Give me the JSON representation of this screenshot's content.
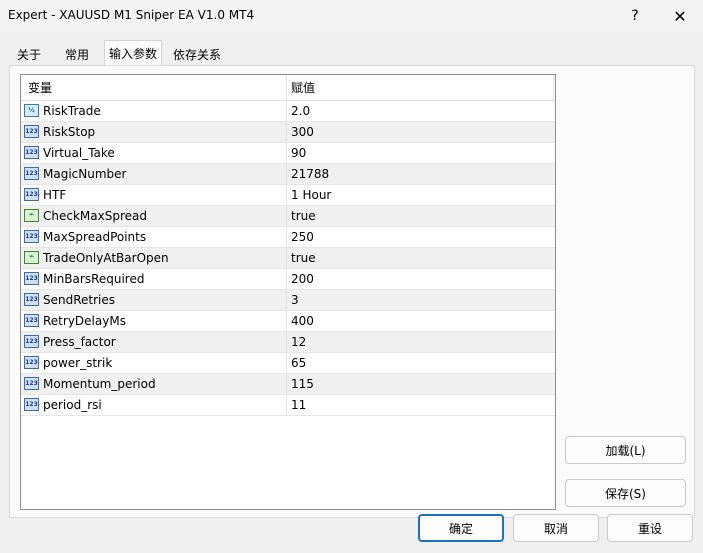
{
  "window": {
    "title": "Expert - XAUUSD M1 Sniper EA V1.0 MT4",
    "help_label": "?",
    "close_label": "✕"
  },
  "tabs": [
    {
      "label": "关于"
    },
    {
      "label": "常用"
    },
    {
      "label": "输入参数"
    },
    {
      "label": "依存关系"
    }
  ],
  "table": {
    "headers": {
      "variable": "变量",
      "value": "赋值"
    },
    "rows": [
      {
        "name": "RiskTrade",
        "value": "2.0",
        "icon": "double-type-icon",
        "glyph": "½"
      },
      {
        "name": "RiskStop",
        "value": "300",
        "icon": "integer-type-icon",
        "glyph": "123"
      },
      {
        "name": "Virtual_Take",
        "value": "90",
        "icon": "integer-type-icon",
        "glyph": "123"
      },
      {
        "name": "MagicNumber",
        "value": "21788",
        "icon": "integer-type-icon",
        "glyph": "123"
      },
      {
        "name": "HTF",
        "value": "1 Hour",
        "icon": "integer-type-icon",
        "glyph": "123"
      },
      {
        "name": "CheckMaxSpread",
        "value": "true",
        "icon": "bool-type-icon",
        "glyph": "⌁"
      },
      {
        "name": "MaxSpreadPoints",
        "value": "250",
        "icon": "integer-type-icon",
        "glyph": "123"
      },
      {
        "name": "TradeOnlyAtBarOpen",
        "value": "true",
        "icon": "bool-type-icon",
        "glyph": "⌁"
      },
      {
        "name": "MinBarsRequired",
        "value": "200",
        "icon": "integer-type-icon",
        "glyph": "123"
      },
      {
        "name": "SendRetries",
        "value": "3",
        "icon": "integer-type-icon",
        "glyph": "123"
      },
      {
        "name": "RetryDelayMs",
        "value": "400",
        "icon": "integer-type-icon",
        "glyph": "123"
      },
      {
        "name": "Press_factor",
        "value": "12",
        "icon": "integer-type-icon",
        "glyph": "123"
      },
      {
        "name": "power_strik",
        "value": "65",
        "icon": "integer-type-icon",
        "glyph": "123"
      },
      {
        "name": "Momentum_period",
        "value": "115",
        "icon": "integer-type-icon",
        "glyph": "123"
      },
      {
        "name": "period_rsi",
        "value": "11",
        "icon": "integer-type-icon",
        "glyph": "123"
      }
    ]
  },
  "buttons": {
    "load": "加载(L)",
    "save": "保存(S)",
    "ok": "确定",
    "cancel": "取消",
    "reset": "重设"
  }
}
